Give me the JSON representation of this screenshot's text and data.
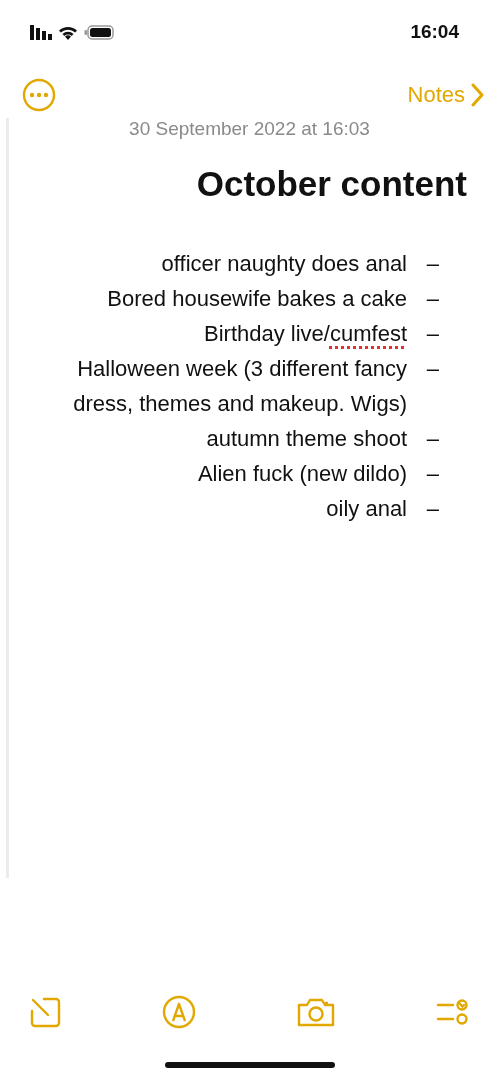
{
  "status_bar": {
    "time": "16:04"
  },
  "nav": {
    "back_label": "Notes"
  },
  "note": {
    "date": "30 September 2022 at 16:03",
    "title": "October content",
    "items": [
      {
        "marker": "–",
        "parts": [
          {
            "text": "officer naughty does anal",
            "misspelled": false
          }
        ]
      },
      {
        "marker": "–",
        "parts": [
          {
            "text": "Bored housewife bakes a cake",
            "misspelled": false
          }
        ]
      },
      {
        "marker": "–",
        "parts": [
          {
            "text": "Birthday live/",
            "misspelled": false
          },
          {
            "text": "cumfest",
            "misspelled": true
          }
        ]
      },
      {
        "marker": "–",
        "parts": [
          {
            "text": "Halloween week (3 different fancy dress, themes and makeup. Wigs)",
            "misspelled": false
          }
        ]
      },
      {
        "marker": "–",
        "parts": [
          {
            "text": "autumn theme shoot",
            "misspelled": false
          }
        ]
      },
      {
        "marker": "–",
        "parts": [
          {
            "text": "Alien fuck (new dildo)",
            "misspelled": false
          }
        ]
      },
      {
        "marker": "–",
        "parts": [
          {
            "text": "oily anal",
            "misspelled": false
          }
        ]
      }
    ]
  },
  "toolbar": [
    {
      "kind": "checklist"
    },
    {
      "kind": "camera"
    },
    {
      "kind": "markup"
    },
    {
      "kind": "compose"
    }
  ]
}
